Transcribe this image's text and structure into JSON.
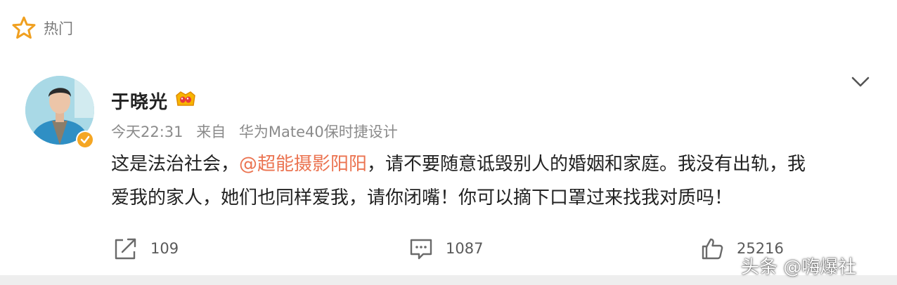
{
  "header": {
    "hot_label": "热门",
    "icon": "star-icon"
  },
  "post": {
    "author": "于晓光",
    "time": "今天22:31",
    "source_prefix": "来自",
    "source_device": "华为Mate40保时捷设计",
    "body": {
      "line1_before": "这是法治社会，",
      "mention": "@超能摄影阳阳",
      "line1_after": "，请不要随意诋毁别人的婚姻和家庭。我没有出轨，我",
      "line2": "爱我的家人，她们也同样爱我，请你闭嘴！你可以摘下口罩过来找我对质吗！"
    }
  },
  "actions": {
    "repost_count": "109",
    "comment_count": "1087",
    "like_count": "25216"
  },
  "watermark": {
    "text": "头条 @嗨爆社"
  },
  "colors": {
    "mention": "#eb7350",
    "star": "#f0a020",
    "verified": "#f5a623",
    "text": "#222222",
    "meta": "#8b8b8b"
  }
}
